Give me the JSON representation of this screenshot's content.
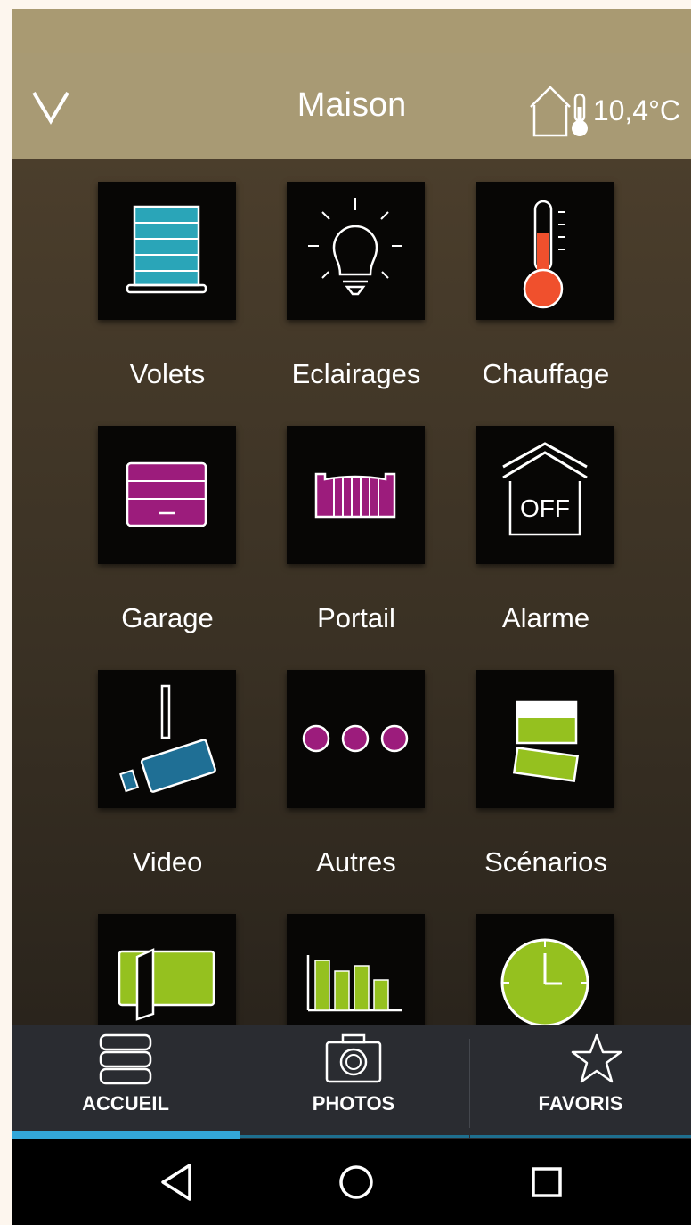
{
  "app_bar": {
    "title": "Maison",
    "temperature": "10,4°C",
    "back_icon": "chevron-down-icon",
    "house_icon": "house-thermometer-icon"
  },
  "tiles": [
    {
      "label": "Volets",
      "icon": "shutter-icon"
    },
    {
      "label": "Eclairages",
      "icon": "lightbulb-icon"
    },
    {
      "label": "Chauffage",
      "icon": "thermometer-icon"
    },
    {
      "label": "Garage",
      "icon": "garage-door-icon"
    },
    {
      "label": "Portail",
      "icon": "gate-icon"
    },
    {
      "label": "Alarme",
      "icon": "alarm-house-icon",
      "badge": "OFF"
    },
    {
      "label": "Video",
      "icon": "camera-icon"
    },
    {
      "label": "Autres",
      "icon": "more-dots-icon"
    },
    {
      "label": "Scénarios",
      "icon": "scenarios-icon"
    },
    {
      "label": "",
      "icon": "door-icon"
    },
    {
      "label": "",
      "icon": "bar-chart-icon"
    },
    {
      "label": "",
      "icon": "clock-icon"
    }
  ],
  "tabs": [
    {
      "label": "ACCUEIL",
      "icon": "stack-icon",
      "active": true
    },
    {
      "label": "PHOTOS",
      "icon": "camera-photo-icon",
      "active": false
    },
    {
      "label": "FAVORIS",
      "icon": "star-icon",
      "active": false
    }
  ],
  "system_nav": [
    {
      "icon": "back-triangle-icon"
    },
    {
      "icon": "home-circle-icon"
    },
    {
      "icon": "recents-square-icon"
    }
  ],
  "colors": {
    "app_bar": "#a89a74",
    "tab_active": "#33a7d9",
    "tab_inactive": "#1e6f8f",
    "magenta": "#9c1c7c",
    "green": "#95c11f",
    "teal": "#2aa5b8",
    "red_orange": "#f0502d",
    "blue": "#1f6f95"
  }
}
